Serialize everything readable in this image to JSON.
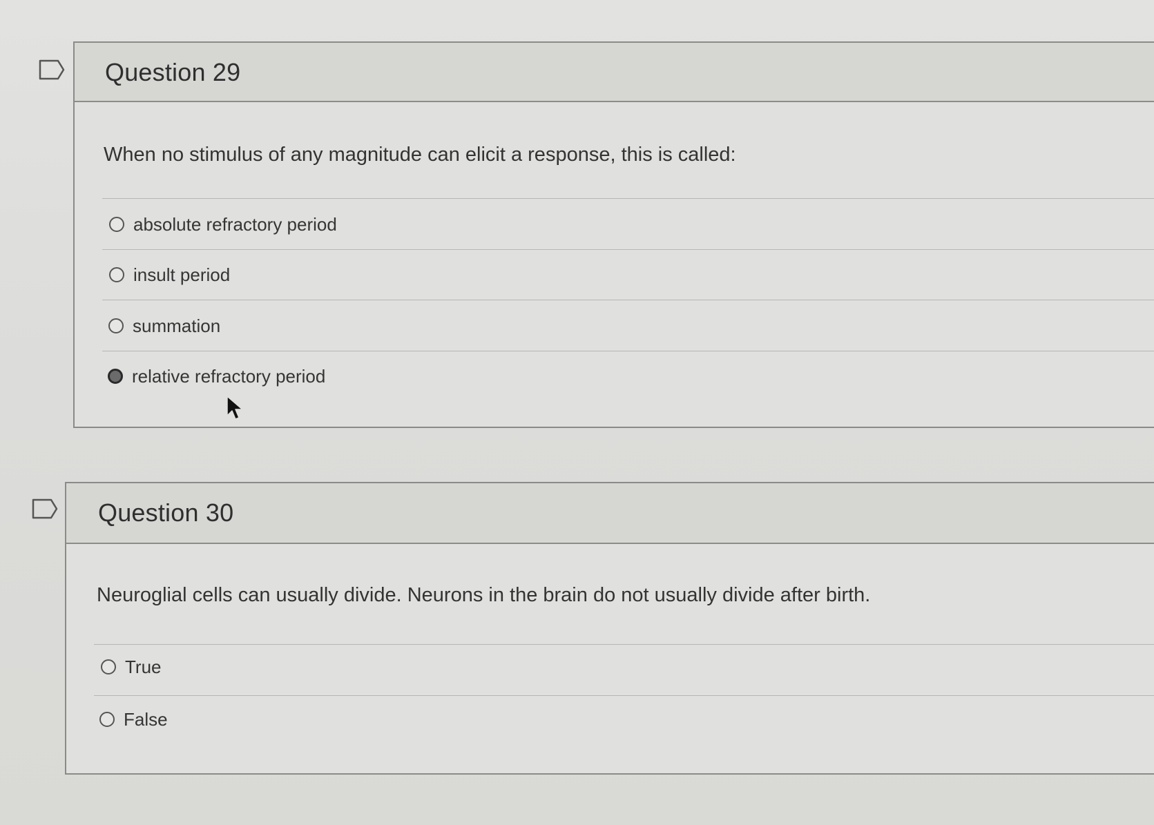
{
  "questions": [
    {
      "title": "Question 29",
      "text": "When no stimulus of any magnitude can elicit a response, this is called:",
      "options": [
        {
          "label": "absolute refractory period",
          "selected": false
        },
        {
          "label": "insult period",
          "selected": false
        },
        {
          "label": "summation",
          "selected": false
        },
        {
          "label": "relative refractory period",
          "selected": true
        }
      ]
    },
    {
      "title": "Question 30",
      "text": "Neuroglial cells can usually divide. Neurons in the brain do not usually divide after birth.",
      "options": [
        {
          "label": "True",
          "selected": false
        },
        {
          "label": "False",
          "selected": false
        }
      ]
    }
  ],
  "icons": {
    "flag": "flag-icon",
    "cursor": "mouse-pointer-icon"
  },
  "colors": {
    "background": "#dcdcda",
    "panel_header": "#d6d6d3",
    "panel_body": "#e0e0de",
    "border": "#8a8a88",
    "text": "#333333"
  }
}
